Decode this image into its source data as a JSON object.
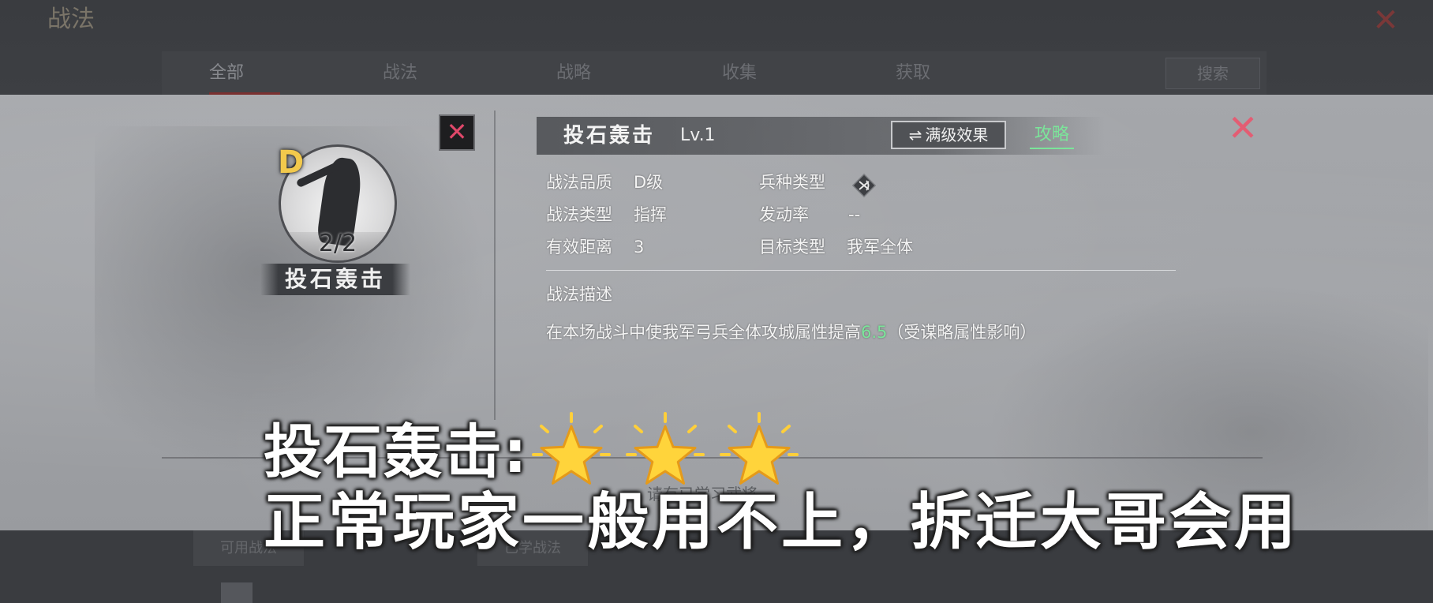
{
  "background": {
    "logo_text": "战法",
    "close_glyph": "✕",
    "tabs": [
      "全部",
      "战法",
      "战略",
      "收集",
      "获取"
    ],
    "search_label": "搜索",
    "bottom_buttons": [
      "可用战法",
      "",
      "",
      "",
      "已学战法"
    ]
  },
  "skill_card": {
    "grade": "D",
    "count": "2/2",
    "name": "投石轰击",
    "dismiss_glyph": "✕"
  },
  "header": {
    "title": "投石轰击",
    "level": "Lv.1",
    "max_effect_label": "满级效果",
    "swap_glyph": "⇌",
    "guide_label": "攻略",
    "close_glyph": "✕"
  },
  "attributes": {
    "quality_label": "战法品质",
    "quality_value": "D级",
    "type_label": "战法类型",
    "type_value": "指挥",
    "range_label": "有效距离",
    "range_value": "3",
    "troop_label": "兵种类型",
    "troop_icon": "crossbow-icon",
    "activation_label": "发动率",
    "activation_value": "--",
    "target_label": "目标类型",
    "target_value": "我军全体"
  },
  "description": {
    "heading": "战法描述",
    "text_before": "在本场战斗中使我军弓兵全体攻城属性提高",
    "highlight_value": "6.5",
    "text_after": "（受谋略属性影响）"
  },
  "faint_center_text": "请有已学习武将",
  "caption": {
    "line1": "投石轰击:",
    "stars": 3,
    "star_icon": "star-icon",
    "line2": "正常玩家一般用不上，拆迁大哥会用"
  },
  "colors": {
    "highlight_green": "#7be59a",
    "close_red": "#e35d73",
    "grade_gold": "#f2c94c",
    "star_yellow": "#ffd43b"
  }
}
